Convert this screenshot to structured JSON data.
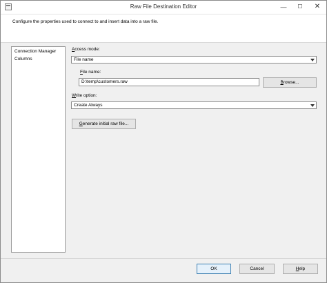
{
  "window": {
    "title": "Raw File Destination Editor",
    "minimize_glyph": "—",
    "maximize_glyph": "☐",
    "close_glyph": "✕"
  },
  "header": {
    "description": "Configure the properties used to connect to and insert data into a raw file."
  },
  "sidebar": {
    "items": [
      {
        "label": "Connection Manager"
      },
      {
        "label": "Columns"
      }
    ]
  },
  "form": {
    "access_mode": {
      "label_access": "A",
      "label_rest": "ccess mode:",
      "value": "File name"
    },
    "file_name": {
      "label_access": "F",
      "label_rest": "ile name:",
      "value": "D:\\temp\\customers.raw"
    },
    "browse_button": {
      "label_access": "B",
      "label_rest": "rowse..."
    },
    "write_option": {
      "label_access": "W",
      "label_rest": "rite option:",
      "value": "Create Always"
    },
    "generate_button": {
      "label_access": "G",
      "label_rest": "enerate initial raw file..."
    }
  },
  "footer": {
    "ok_label": "OK",
    "cancel_label": "Cancel",
    "help_access": "H",
    "help_rest": "elp"
  },
  "icons": [
    "window-icon",
    "minimize-icon",
    "maximize-icon",
    "close-icon",
    "dropdown-arrow-icon"
  ]
}
